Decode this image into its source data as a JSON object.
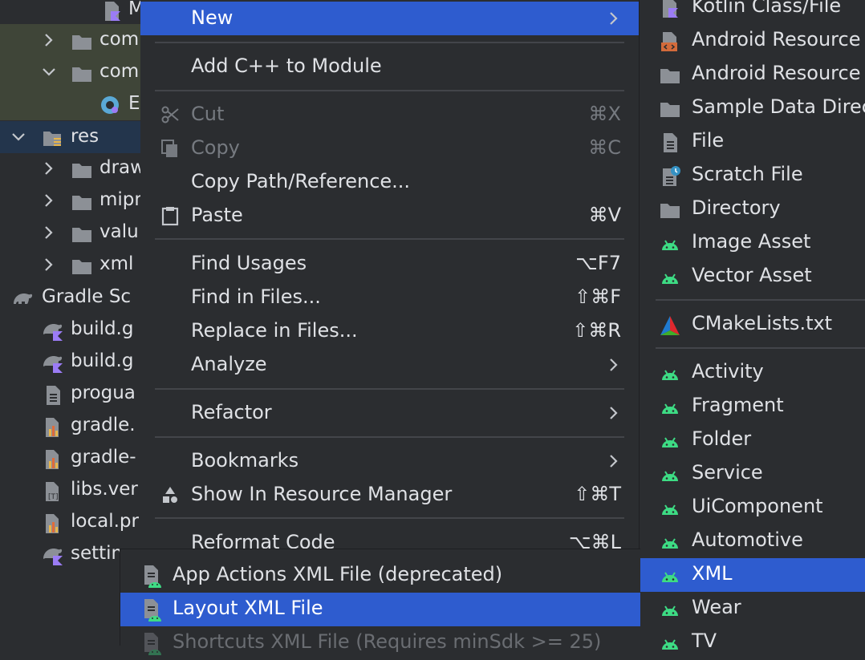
{
  "project_tree": {
    "rows": [
      {
        "label": "M",
        "kind": "kotlin-file",
        "chevron": "none"
      },
      {
        "label": "com",
        "kind": "folder",
        "chevron": "right"
      },
      {
        "label": "com",
        "kind": "folder",
        "chevron": "down"
      },
      {
        "label": "E",
        "kind": "class-file",
        "chevron": "none"
      },
      {
        "label": "res",
        "kind": "res-folder",
        "chevron": "down"
      },
      {
        "label": "draw",
        "kind": "folder",
        "chevron": "right"
      },
      {
        "label": "mipm",
        "kind": "folder",
        "chevron": "right"
      },
      {
        "label": "valu",
        "kind": "folder",
        "chevron": "right"
      },
      {
        "label": "xml",
        "kind": "folder",
        "chevron": "right"
      },
      {
        "label": "Gradle Sc",
        "kind": "gradle",
        "chevron": "none"
      },
      {
        "label": "build.g",
        "kind": "gradle-kts",
        "chevron": "none"
      },
      {
        "label": "build.g",
        "kind": "gradle-kts",
        "chevron": "none"
      },
      {
        "label": "progua",
        "kind": "text-file",
        "chevron": "none"
      },
      {
        "label": "gradle.",
        "kind": "properties-file",
        "chevron": "none"
      },
      {
        "label": "gradle-",
        "kind": "properties-file",
        "chevron": "none"
      },
      {
        "label": "libs.ver",
        "kind": "toml-file",
        "chevron": "none"
      },
      {
        "label": "local.pr",
        "kind": "properties-file",
        "chevron": "none"
      },
      {
        "label": "settin",
        "kind": "gradle-kts",
        "chevron": "none"
      }
    ]
  },
  "context_menu": {
    "items": [
      {
        "label": "New",
        "shortcut": "",
        "submenu": true,
        "state": "active",
        "icon": ""
      },
      {
        "sep": true
      },
      {
        "label": "Add C++ to Module",
        "shortcut": "",
        "submenu": false,
        "state": "normal",
        "icon": ""
      },
      {
        "sep": true
      },
      {
        "label": "Cut",
        "shortcut": "⌘X",
        "submenu": false,
        "state": "disabled",
        "icon": "scissors-icon"
      },
      {
        "label": "Copy",
        "shortcut": "⌘C",
        "submenu": false,
        "state": "disabled",
        "icon": "copy-icon"
      },
      {
        "label": "Copy Path/Reference...",
        "shortcut": "",
        "submenu": false,
        "state": "normal",
        "icon": ""
      },
      {
        "label": "Paste",
        "shortcut": "⌘V",
        "submenu": false,
        "state": "normal",
        "icon": "clipboard-icon"
      },
      {
        "sep": true
      },
      {
        "label": "Find Usages",
        "shortcut": "⌥F7",
        "submenu": false,
        "state": "normal",
        "icon": ""
      },
      {
        "label": "Find in Files...",
        "shortcut": "⇧⌘F",
        "submenu": false,
        "state": "normal",
        "icon": ""
      },
      {
        "label": "Replace in Files...",
        "shortcut": "⇧⌘R",
        "submenu": false,
        "state": "normal",
        "icon": ""
      },
      {
        "label": "Analyze",
        "shortcut": "",
        "submenu": true,
        "state": "normal",
        "icon": ""
      },
      {
        "sep": true
      },
      {
        "label": "Refactor",
        "shortcut": "",
        "submenu": true,
        "state": "normal",
        "icon": ""
      },
      {
        "sep": true
      },
      {
        "label": "Bookmarks",
        "shortcut": "",
        "submenu": true,
        "state": "normal",
        "icon": ""
      },
      {
        "label": "Show In Resource Manager",
        "shortcut": "⇧⌘T",
        "submenu": false,
        "state": "normal",
        "icon": "shapes-icon"
      },
      {
        "sep": true
      },
      {
        "label": "Reformat Code",
        "shortcut": "⌥⌘L",
        "submenu": false,
        "state": "normal",
        "icon": ""
      }
    ]
  },
  "new_submenu": {
    "items": [
      {
        "label": "Kotlin Class/File",
        "icon": "kotlin-file-icon",
        "state": "normal"
      },
      {
        "label": "Android Resource File",
        "icon": "android-resource-file-icon",
        "state": "normal"
      },
      {
        "label": "Android Resource Directory",
        "icon": "folder-icon",
        "state": "normal"
      },
      {
        "label": "Sample Data Directory",
        "icon": "folder-icon",
        "state": "normal"
      },
      {
        "label": "File",
        "icon": "file-icon",
        "state": "normal"
      },
      {
        "label": "Scratch File",
        "icon": "scratch-file-icon",
        "state": "normal"
      },
      {
        "label": "Directory",
        "icon": "folder-icon",
        "state": "normal"
      },
      {
        "label": "Image Asset",
        "icon": "android-icon",
        "state": "normal"
      },
      {
        "label": "Vector Asset",
        "icon": "android-icon",
        "state": "normal"
      },
      {
        "sep": true
      },
      {
        "label": "CMakeLists.txt",
        "icon": "cmake-icon",
        "state": "normal"
      },
      {
        "sep": true
      },
      {
        "label": "Activity",
        "icon": "android-icon",
        "state": "normal"
      },
      {
        "label": "Fragment",
        "icon": "android-icon",
        "state": "normal"
      },
      {
        "label": "Folder",
        "icon": "android-icon",
        "state": "normal"
      },
      {
        "label": "Service",
        "icon": "android-icon",
        "state": "normal"
      },
      {
        "label": "UiComponent",
        "icon": "android-icon",
        "state": "normal"
      },
      {
        "label": "Automotive",
        "icon": "android-icon",
        "state": "normal"
      },
      {
        "label": "XML",
        "icon": "android-icon",
        "state": "active"
      },
      {
        "label": "Wear",
        "icon": "android-icon",
        "state": "normal"
      },
      {
        "label": "TV",
        "icon": "android-icon",
        "state": "normal"
      }
    ]
  },
  "xml_submenu": {
    "items": [
      {
        "label": "App Actions XML File (deprecated)",
        "icon": "xml-file-icon",
        "state": "normal"
      },
      {
        "label": "Layout XML File",
        "icon": "xml-file-icon",
        "state": "active"
      },
      {
        "label": "Shortcuts XML File (Requires minSdk >= 25)",
        "icon": "xml-file-icon",
        "state": "disabled"
      }
    ]
  },
  "colors": {
    "background": "#2b2d30",
    "selection": "#2e5ccf",
    "android_green": "#3ddc84",
    "text": "#dfe1e5",
    "disabled_text": "#767a80"
  }
}
